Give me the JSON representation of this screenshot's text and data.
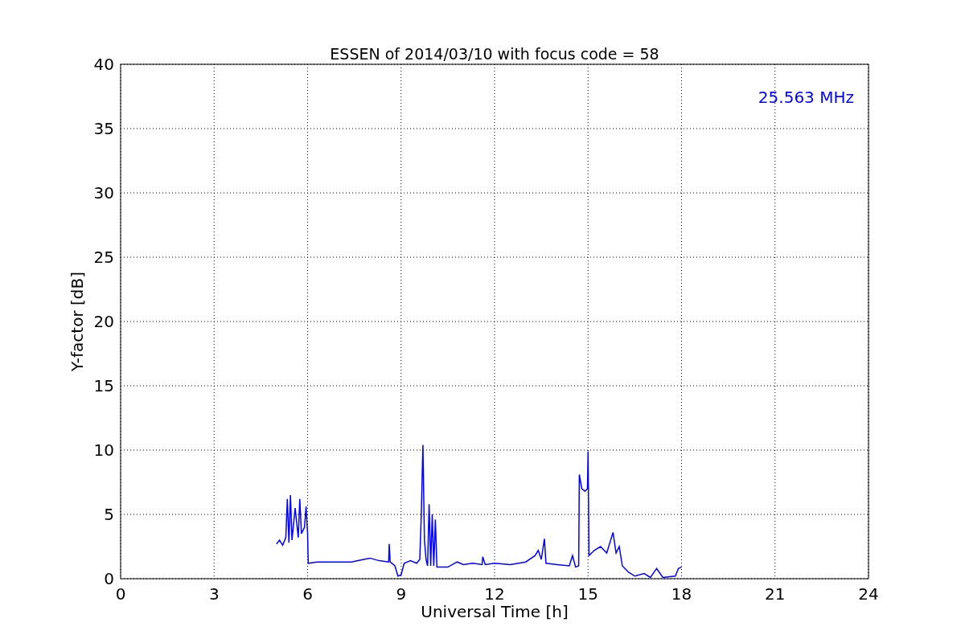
{
  "chart_data": {
    "type": "line",
    "title": "ESSEN of 2014/03/10 with focus code = 58",
    "xlabel": "Universal Time [h]",
    "ylabel": "Y-factor [dB]",
    "x": [
      5.0,
      5.1,
      5.2,
      5.3,
      5.35,
      5.4,
      5.45,
      5.5,
      5.6,
      5.7,
      5.75,
      5.8,
      5.9,
      5.95,
      6.0,
      6.02,
      6.3,
      6.6,
      7.0,
      7.4,
      7.8,
      8.0,
      8.3,
      8.6,
      8.62,
      8.65,
      8.8,
      8.9,
      9.0,
      9.1,
      9.3,
      9.5,
      9.6,
      9.65,
      9.7,
      9.75,
      9.8,
      9.85,
      9.9,
      9.95,
      10.0,
      10.05,
      10.1,
      10.15,
      10.3,
      10.5,
      10.8,
      11.0,
      11.3,
      11.6,
      11.62,
      11.7,
      12.0,
      12.5,
      13.0,
      13.3,
      13.4,
      13.5,
      13.6,
      13.65,
      14.0,
      14.4,
      14.5,
      14.6,
      14.7,
      14.72,
      14.8,
      14.9,
      14.98,
      15.0,
      15.03,
      15.2,
      15.4,
      15.6,
      15.8,
      15.9,
      16.0,
      16.1,
      16.3,
      16.5,
      16.8,
      17.0,
      17.2,
      17.4,
      17.8,
      17.9,
      18.0
    ],
    "series": [
      {
        "name": "25.563 MHz",
        "color": "#0000ff",
        "values": [
          2.7,
          3.0,
          2.6,
          3.2,
          6.2,
          2.8,
          6.5,
          3.0,
          5.5,
          3.2,
          6.2,
          3.5,
          4.0,
          5.6,
          3.5,
          1.2,
          1.3,
          1.3,
          1.3,
          1.3,
          1.5,
          1.6,
          1.4,
          1.3,
          2.7,
          1.3,
          1.0,
          0.2,
          0.3,
          1.2,
          1.4,
          1.2,
          1.5,
          5.0,
          10.4,
          3.0,
          1.5,
          1.0,
          5.8,
          1.0,
          5.0,
          1.0,
          4.6,
          0.9,
          0.9,
          0.9,
          1.3,
          1.1,
          1.2,
          1.1,
          1.7,
          1.1,
          1.2,
          1.1,
          1.3,
          1.8,
          2.2,
          1.5,
          3.1,
          1.2,
          1.1,
          1.0,
          1.8,
          0.9,
          1.0,
          8.1,
          7.0,
          6.8,
          7.0,
          9.9,
          1.8,
          2.2,
          2.5,
          2.0,
          3.6,
          2.0,
          2.5,
          1.0,
          0.5,
          0.2,
          0.4,
          0.1,
          0.8,
          0.1,
          0.2,
          0.8,
          0.9
        ]
      }
    ],
    "xlim": [
      0,
      24
    ],
    "ylim": [
      0,
      40
    ],
    "xticks": [
      0,
      3,
      6,
      9,
      12,
      15,
      18,
      21,
      24
    ],
    "yticks": [
      0,
      5,
      10,
      15,
      20,
      25,
      30,
      35,
      40
    ],
    "grid": true
  }
}
